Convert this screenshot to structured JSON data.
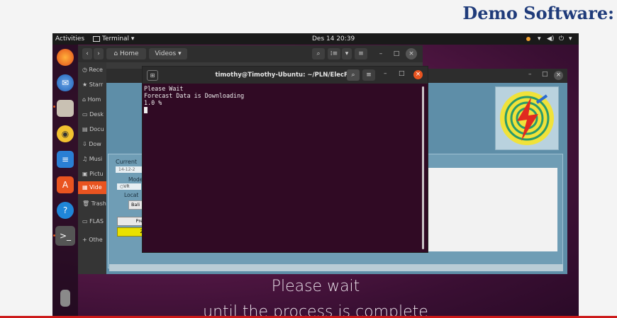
{
  "slide": {
    "title": "Demo Software:"
  },
  "topbar": {
    "activities": "Activities",
    "app_menu": "Terminal ▾",
    "datetime": "Des 14  20:39",
    "status_icons": [
      "orange-dot-icon",
      "wifi-icon",
      "volume-icon",
      "power-icon",
      "chevron-down-icon"
    ]
  },
  "dock": {
    "items": [
      "firefox-icon",
      "thunderbird-icon",
      "files-icon",
      "rhythmbox-icon",
      "writer-icon",
      "software-center-icon",
      "help-icon",
      "terminal-icon",
      "usb-drive-icon",
      "app-grid-icon"
    ]
  },
  "files": {
    "nav_home": "Home",
    "nav_videos": "Videos",
    "sidebar": [
      "Rece",
      "Starr",
      "Hom",
      "Desk",
      "Docu",
      "Dow",
      "Musi",
      "Pictu",
      "Vide",
      "Trash",
      "FLAS",
      "+ Othe"
    ],
    "active_index": 8
  },
  "app": {
    "current_label": "Current",
    "date_value": "14-12-2",
    "mode_label": "Mode",
    "mode_option": "VR",
    "location_label": "Locat",
    "location_value": "Bali",
    "predict_button": "Pred",
    "zoom_button": "Zo"
  },
  "terminal": {
    "title": "timothy@Timothy-Ubuntu: ~/PLN/ElecFor",
    "lines": [
      "Please Wait",
      "Forecast Data is Downloading",
      "1.0 %"
    ]
  },
  "caption": {
    "line1": "Please wait",
    "line2": "until the process is complete"
  },
  "colors": {
    "ubuntu_orange": "#e95420",
    "terminal_bg": "#300a24",
    "app_bg": "#5e8ea8",
    "title_blue": "#1f3b7a"
  }
}
